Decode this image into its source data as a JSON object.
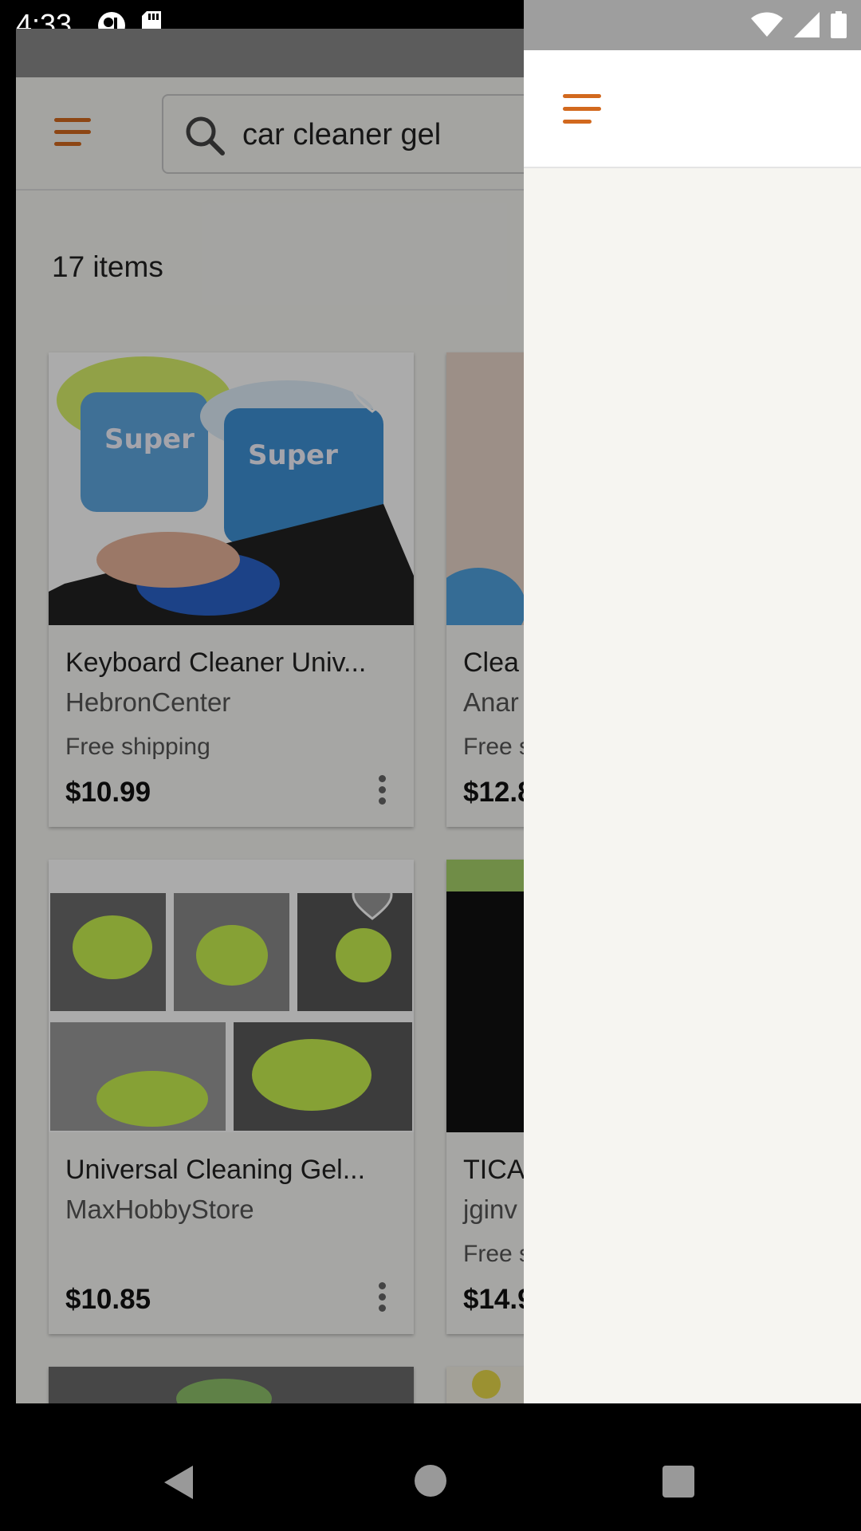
{
  "status": {
    "time": "4:33"
  },
  "search": {
    "query": "car cleaner gel"
  },
  "results": {
    "count_label": "17 items"
  },
  "cards": [
    {
      "title": "Keyboard Cleaner Univ...",
      "shop": "HebronCenter",
      "shipping": "Free shipping",
      "price": "$10.99"
    },
    {
      "title": "Clea",
      "shop": "Anar",
      "shipping": "Free s",
      "price": "$12.8"
    },
    {
      "title": "Universal Cleaning Gel...",
      "shop": "MaxHobbyStore",
      "shipping": "",
      "price": "$10.85"
    },
    {
      "title": "TICA",
      "shop": "jginv",
      "shipping": "Free s",
      "price": "$14.9"
    }
  ],
  "colors": {
    "accent": "#d2691e",
    "drawer_bg": "#f6f5f1",
    "scrim": "rgba(0,0,0,0.33)"
  },
  "icons": [
    "menu-icon",
    "search-icon",
    "heart-icon",
    "more-vert-icon",
    "wifi-icon",
    "signal-icon",
    "battery-icon",
    "back-icon",
    "home-icon",
    "recents-icon"
  ]
}
